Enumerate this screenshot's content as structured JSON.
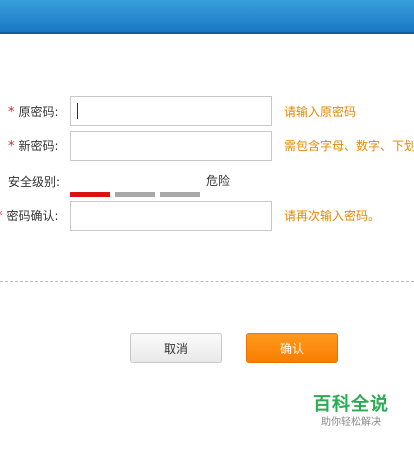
{
  "form": {
    "old_password": {
      "required_mark": "*",
      "label": "原密码:",
      "value": "",
      "hint": "请输入原密码"
    },
    "new_password": {
      "required_mark": "*",
      "label": "新密码:",
      "value": "",
      "hint": "需包含字母、数字、下划"
    },
    "strength": {
      "label": "安全级别:",
      "value_text": "危险",
      "level": 1,
      "levels_total": 3,
      "active_color": "#dd1111",
      "inactive_color": "#a8a8a8"
    },
    "confirm_password": {
      "required_mark": "*",
      "label": "密码确认:",
      "value": "",
      "hint": "请再次输入密码。"
    }
  },
  "buttons": {
    "cancel_label": "取消",
    "confirm_label": "确认"
  },
  "colors": {
    "header": "#1a78c2",
    "hint": "#e08a00",
    "required": "#e02020",
    "confirm_button": "#f97d00",
    "watermark": "#2bab52"
  },
  "watermark": {
    "title": "百科全说",
    "subtitle": "助你轻松解决"
  }
}
